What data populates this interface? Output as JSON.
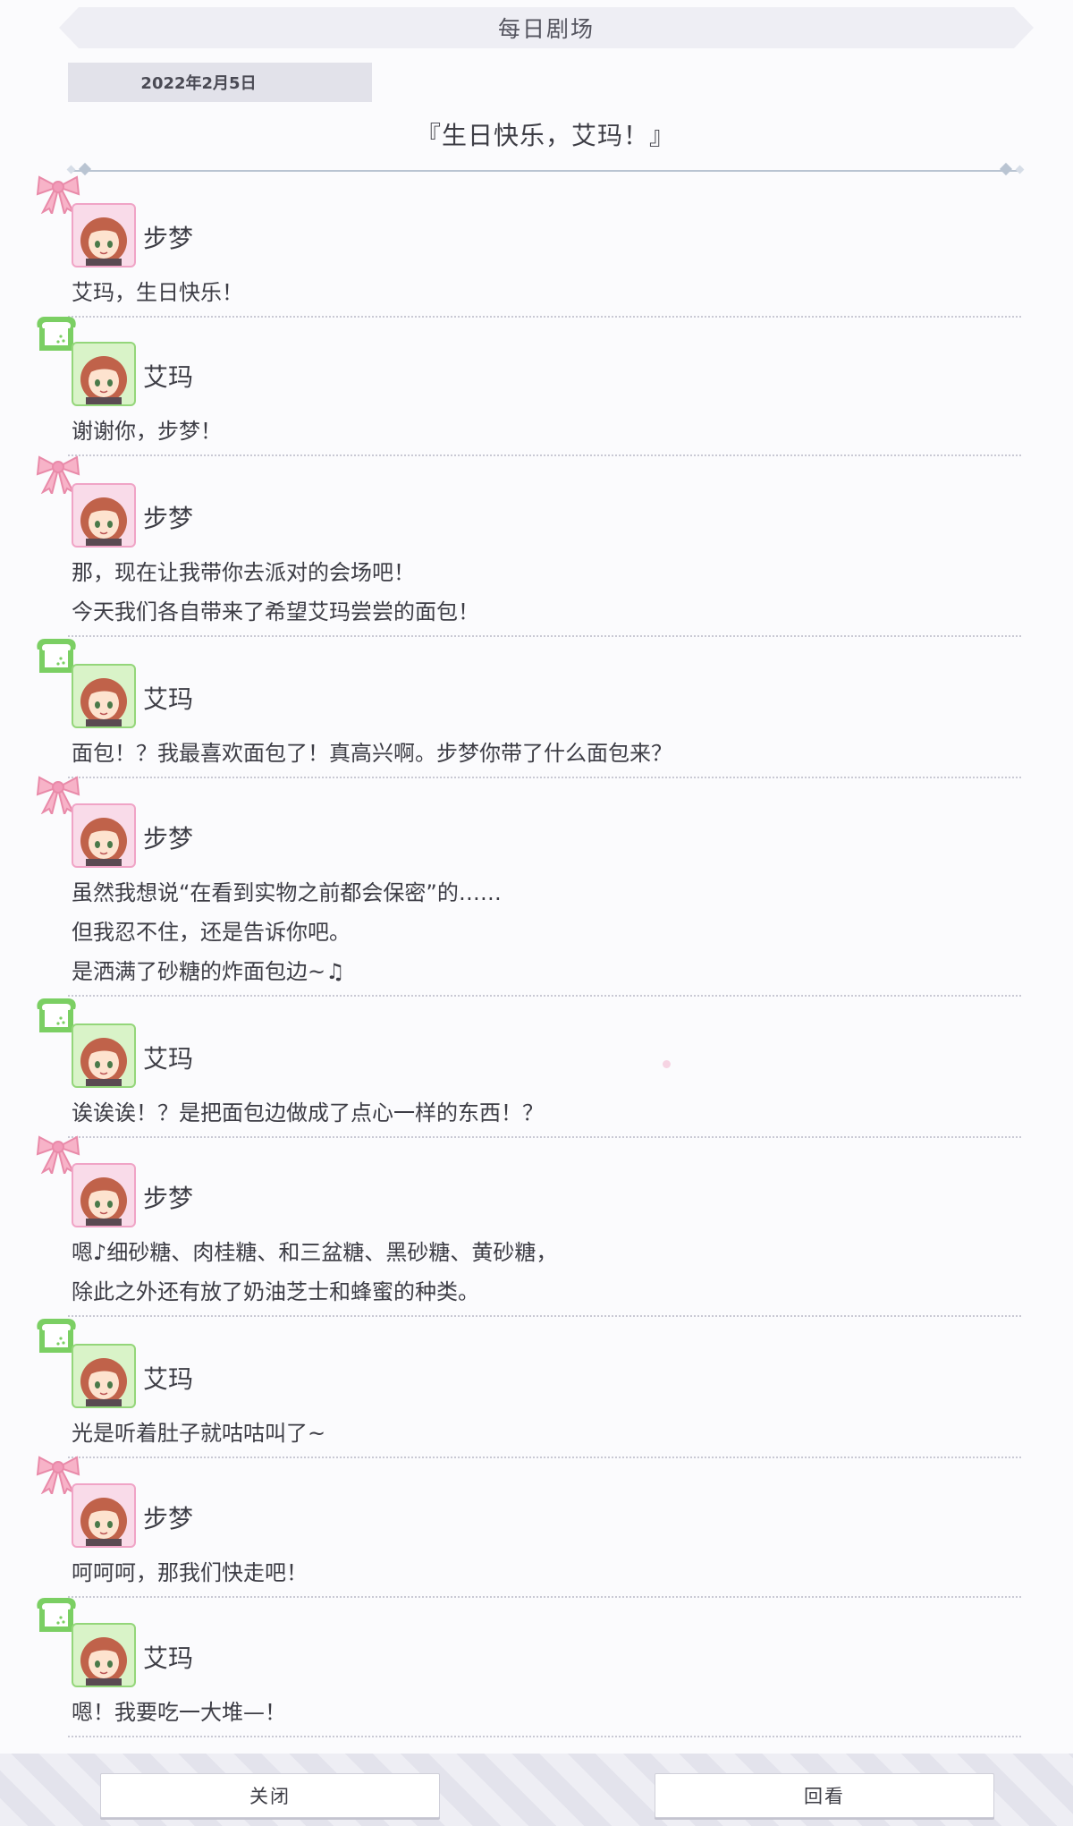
{
  "header": {
    "title": "每日剧场"
  },
  "date": "2022年2月5日",
  "story_title": "『生日快乐，艾玛！』",
  "speakers": {
    "ayumu": "步梦",
    "emma": "艾玛"
  },
  "colors": {
    "ayumu_accent": "#f0a4c6",
    "emma_accent": "#94d67a"
  },
  "entries": [
    {
      "who": "ayumu",
      "speaker": "步梦",
      "icon": "ribbon-icon",
      "lines": [
        "艾玛，生日快乐！"
      ]
    },
    {
      "who": "emma",
      "speaker": "艾玛",
      "icon": "bread-icon",
      "lines": [
        "谢谢你，步梦！"
      ]
    },
    {
      "who": "ayumu",
      "speaker": "步梦",
      "icon": "ribbon-icon",
      "lines": [
        "那，现在让我带你去派对的会场吧！",
        "今天我们各自带来了希望艾玛尝尝的面包！"
      ]
    },
    {
      "who": "emma",
      "speaker": "艾玛",
      "icon": "bread-icon",
      "lines": [
        "面包！？我最喜欢面包了！真高兴啊。步梦你带了什么面包来？"
      ]
    },
    {
      "who": "ayumu",
      "speaker": "步梦",
      "icon": "ribbon-icon",
      "lines": [
        "虽然我想说“在看到实物之前都会保密”的……",
        "但我忍不住，还是告诉你吧。",
        "是洒满了砂糖的炸面包边~♫"
      ]
    },
    {
      "who": "emma",
      "speaker": "艾玛",
      "icon": "bread-icon",
      "lines": [
        "诶诶诶！？是把面包边做成了点心一样的东西！？"
      ]
    },
    {
      "who": "ayumu",
      "speaker": "步梦",
      "icon": "ribbon-icon",
      "lines": [
        "嗯♪细砂糖、肉桂糖、和三盆糖、黑砂糖、黄砂糖，",
        "除此之外还有放了奶油芝士和蜂蜜的种类。"
      ]
    },
    {
      "who": "emma",
      "speaker": "艾玛",
      "icon": "bread-icon",
      "lines": [
        "光是听着肚子就咕咕叫了~"
      ]
    },
    {
      "who": "ayumu",
      "speaker": "步梦",
      "icon": "ribbon-icon",
      "lines": [
        "呵呵呵，那我们快走吧！"
      ]
    },
    {
      "who": "emma",
      "speaker": "艾玛",
      "icon": "bread-icon",
      "lines": [
        "嗯！我要吃一大堆—！"
      ]
    }
  ],
  "footer": {
    "close_label": "关闭",
    "review_label": "回看"
  }
}
